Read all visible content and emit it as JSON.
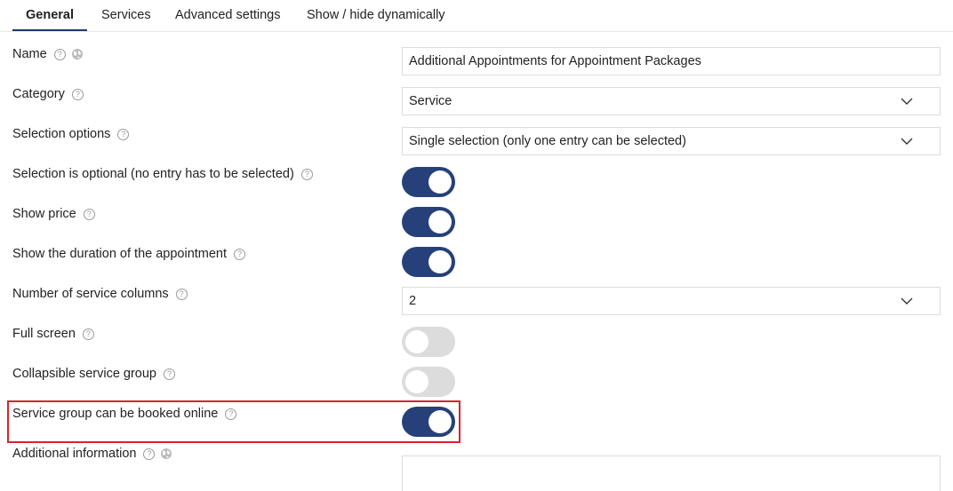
{
  "tabs": [
    {
      "label": "General",
      "active": true
    },
    {
      "label": "Services"
    },
    {
      "label": "Advanced settings"
    },
    {
      "label": "Show / hide dynamically"
    }
  ],
  "help_glyph": "?",
  "fields": {
    "name": {
      "label": "Name",
      "value": "Additional Appointments for Appointment Packages"
    },
    "category": {
      "label": "Category",
      "value": "Service"
    },
    "selection_options": {
      "label": "Selection options",
      "value": "Single selection (only one entry can be selected)"
    },
    "selection_optional": {
      "label": "Selection is optional (no entry has to be selected)",
      "on": true
    },
    "show_price": {
      "label": "Show price",
      "on": true
    },
    "show_duration": {
      "label": "Show the duration of the appointment",
      "on": true
    },
    "service_columns": {
      "label": "Number of service columns",
      "value": "2"
    },
    "full_screen": {
      "label": "Full screen",
      "on": false
    },
    "collapsible_group": {
      "label": "Collapsible service group",
      "on": false
    },
    "bookable_online": {
      "label": "Service group can be booked online",
      "on": true
    },
    "additional_info": {
      "label": "Additional information",
      "value": ""
    }
  },
  "colors": {
    "toggle_on": "#26407a",
    "toggle_off": "#dcdcdc",
    "highlight": "#d9232e"
  },
  "icons": [
    "help-icon",
    "globe-icon",
    "chevron-down-icon"
  ]
}
